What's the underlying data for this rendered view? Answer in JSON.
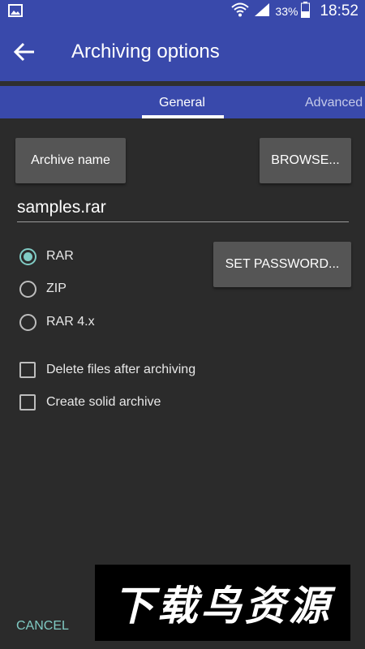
{
  "status_bar": {
    "battery_percent": "33%",
    "time": "18:52",
    "icons": [
      "image-icon",
      "wifi-icon",
      "signal-icon",
      "battery-icon"
    ]
  },
  "app_bar": {
    "title": "Archiving options",
    "back_icon": "back-arrow-icon"
  },
  "tabs": {
    "items": [
      {
        "label": "General",
        "selected": true
      },
      {
        "label": "Advanced",
        "selected": false
      }
    ]
  },
  "general": {
    "archive_name_button": "Archive name",
    "browse_button": "BROWSE...",
    "filename_value": "samples.rar",
    "set_password_button": "SET PASSWORD...",
    "formats": [
      {
        "label": "RAR",
        "checked": true
      },
      {
        "label": "ZIP",
        "checked": false
      },
      {
        "label": "RAR 4.x",
        "checked": false
      }
    ],
    "options": [
      {
        "label": "Delete files after archiving",
        "checked": false
      },
      {
        "label": "Create solid archive",
        "checked": false
      }
    ]
  },
  "footer": {
    "cancel_label": "CANCEL"
  },
  "watermark": {
    "text": "下载鸟资源"
  },
  "colors": {
    "primary": "#3949ab",
    "accent": "#80cbc4",
    "background": "#2b2b2b",
    "button": "#555555"
  }
}
